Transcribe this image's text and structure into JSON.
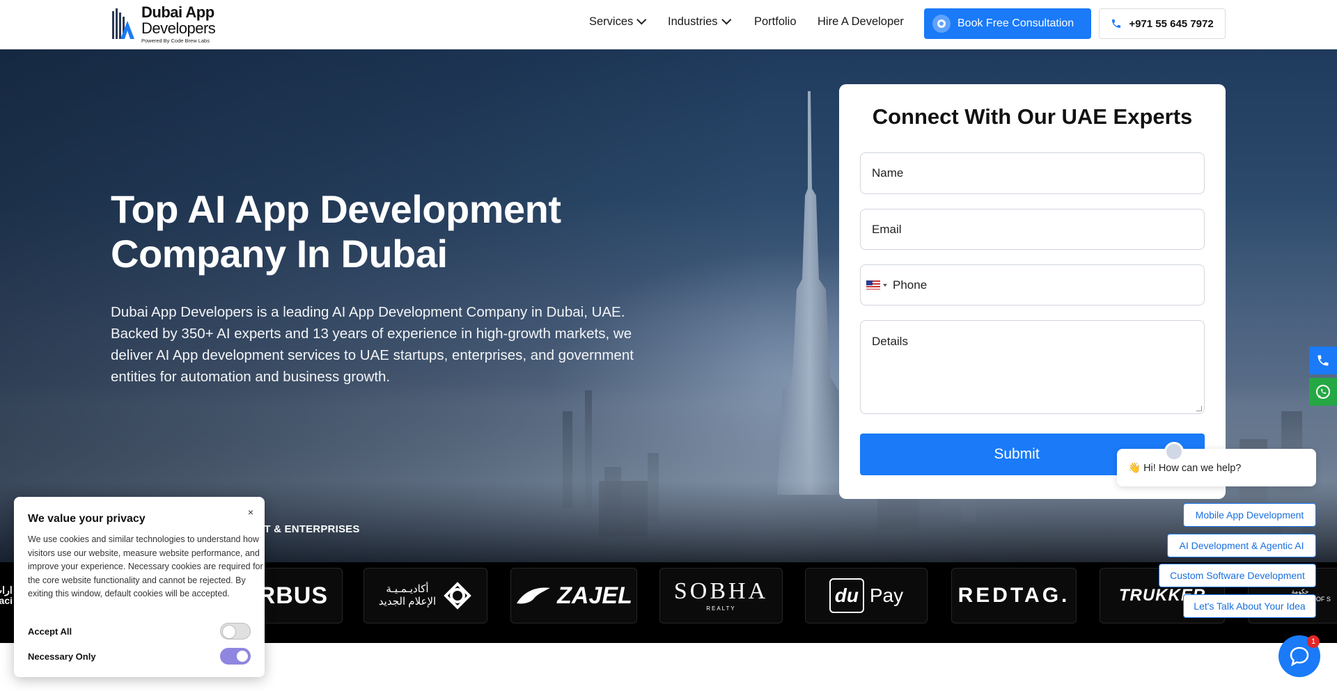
{
  "header": {
    "logo": {
      "line1": "Dubai App",
      "line2": "Developers",
      "tagline": "Powered By Code Brew Labs"
    },
    "nav": [
      {
        "label": "Services",
        "has_dropdown": true
      },
      {
        "label": "Industries",
        "has_dropdown": true
      },
      {
        "label": "Portfolio",
        "has_dropdown": false
      },
      {
        "label": "Hire A Developer",
        "has_dropdown": false
      }
    ],
    "consult_button": "Book Free Consultation",
    "phone_button": "+971 55 645 7972"
  },
  "hero": {
    "title": "Top AI App Development Company In Dubai",
    "description": "Dubai App Developers is a leading AI App Development Company in Dubai, UAE. Backed by 350+ AI experts and 13 years of experience in high-growth markets, we deliver AI App development services to UAE startups, enterprises, and government entities for automation and business growth.",
    "trust_label": "IT & ENTERPRISES"
  },
  "client_logos": [
    {
      "name": "Facilities",
      "text": "ارات\nFaci"
    },
    {
      "name": "Airbus",
      "text": "RBUS"
    },
    {
      "name": "New Media Academy",
      "text": "أكاديـمـيـة\nالإعلام الجديد"
    },
    {
      "name": "Zajel",
      "text": "ZAJEL"
    },
    {
      "name": "Sobha Realty",
      "text": "SOBHA",
      "sub": "REALTY"
    },
    {
      "name": "du Pay",
      "text": "Pay"
    },
    {
      "name": "Redtag",
      "text": "REDTAG."
    },
    {
      "name": "Trukker",
      "text": "TRUKKER"
    },
    {
      "name": "Government",
      "text": "حكومة\nGOVERNMENT OF S"
    }
  ],
  "form": {
    "title": "Connect With Our UAE Experts",
    "name_placeholder": "Name",
    "email_placeholder": "Email",
    "phone_placeholder": "Phone",
    "details_placeholder": "Details",
    "submit": "Submit"
  },
  "chat": {
    "greeting": "👋 Hi! How can we help?",
    "quick_replies": [
      "Mobile App Development",
      "AI Development & Agentic AI",
      "Custom Software Development",
      "Let's Talk About Your Idea"
    ],
    "badge": "1"
  },
  "cookie": {
    "title": "We value your privacy",
    "close": "×",
    "text": "We use cookies and similar technologies to understand how visitors use our website, measure website performance, and improve your experience. Necessary cookies are required for the core website functionality and cannot be rejected. By exiting this window, default cookies will be accepted.",
    "options": [
      {
        "label": "Accept All",
        "enabled": false
      },
      {
        "label": "Necessary Only",
        "enabled": true
      }
    ]
  },
  "colors": {
    "primary": "#1a7af8",
    "whatsapp": "#25a844",
    "toggle_on": "#8f86e0"
  }
}
